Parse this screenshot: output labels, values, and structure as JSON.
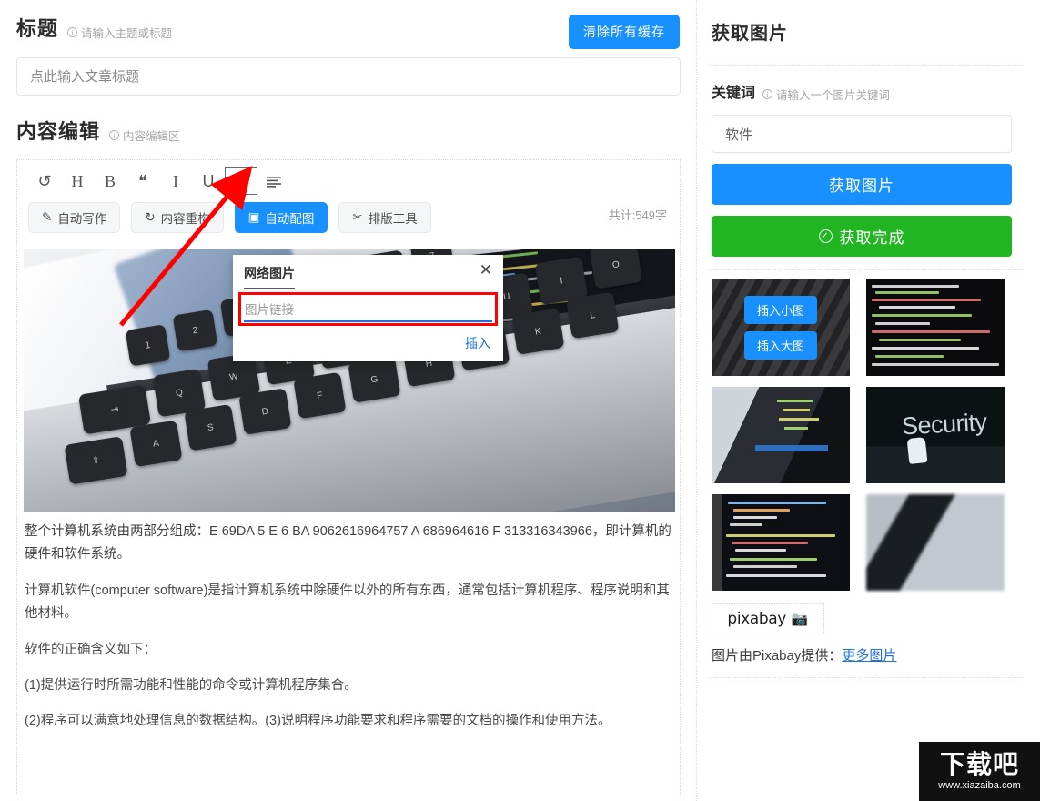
{
  "left": {
    "title_section": {
      "heading": "标题",
      "hint": "请输入主题或标题",
      "clear_cache_label": "清除所有缓存",
      "title_placeholder": "点此输入文章标题"
    },
    "content_section": {
      "heading": "内容编辑",
      "hint": "内容编辑区"
    },
    "toolbar": [
      {
        "name": "undo-icon",
        "glyph": "↺"
      },
      {
        "name": "heading-icon",
        "glyph": "H"
      },
      {
        "name": "bold-icon",
        "glyph": "B"
      },
      {
        "name": "quote-icon",
        "glyph": "❝"
      },
      {
        "name": "italic-icon",
        "glyph": "I"
      },
      {
        "name": "underline-icon",
        "glyph": "U"
      },
      {
        "name": "image-icon",
        "glyph": "🖼"
      },
      {
        "name": "align-icon",
        "glyph": "≡"
      }
    ],
    "actions": [
      {
        "icon": "✎",
        "label": "自动写作",
        "primary": false
      },
      {
        "icon": "↻",
        "label": "内容重构",
        "primary": false
      },
      {
        "icon": "▣",
        "label": "自动配图",
        "primary": true
      },
      {
        "icon": "✂",
        "label": "排版工具",
        "primary": false
      }
    ],
    "word_count": "共计:549字",
    "modal": {
      "title": "网络图片",
      "close": "✕",
      "input_placeholder": "图片链接",
      "insert_label": "插入"
    },
    "body_paragraphs": [
      "整个计算机系统由两部分组成：E 69DA 5 E 6 BA 9062616964757 A 686964616 F 313316343966，即计算机的硬件和软件系统。",
      "计算机软件(computer software)是指计算机系统中除硬件以外的所有东西，通常包括计算机程序、程序说明和其他材料。",
      "软件的正确含义如下：",
      "(1)提供运行时所需功能和性能的命令或计算机程序集合。",
      "(2)程序可以满意地处理信息的数据结构。(3)说明程序功能要求和程序需要的文档的操作和使用方法。"
    ]
  },
  "right": {
    "heading": "获取图片",
    "keyword_label": "关键词",
    "keyword_hint": "请输入一个图片关键词",
    "keyword_value": "软件",
    "keyword_placeholder": "请输入一个图片关键词",
    "fetch_button": "获取图片",
    "done_button": "获取完成",
    "thumb_hover": {
      "small": "插入小图",
      "large": "插入大图"
    },
    "pixabay_word": "pixabay",
    "credit_text": "图片由Pixabay提供：",
    "credit_link": "更多图片"
  },
  "watermark": {
    "main": "下载吧",
    "sub": "www.xiazaiba.com"
  },
  "colors": {
    "primary_blue": "#1890ff",
    "green": "#21b521",
    "link_blue": "#1f6fe0",
    "annotation_red": "#ff0000"
  }
}
